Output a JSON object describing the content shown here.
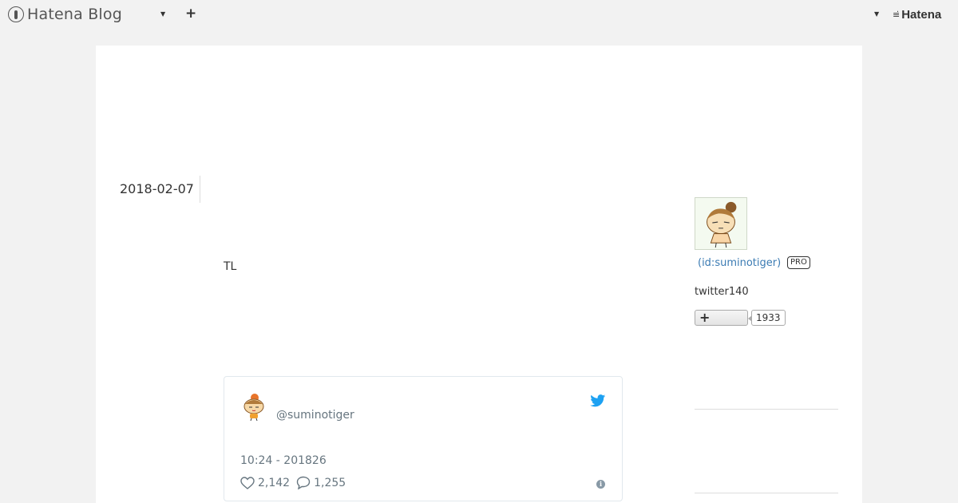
{
  "topbar": {
    "logo_text": "Hatena Blog",
    "brand_right": "Hatena",
    "plus_label": "+"
  },
  "entry": {
    "date": "2018-02-07",
    "text": "TL"
  },
  "tweet": {
    "handle": "@suminotiger",
    "time": "10:24 - 201826",
    "likes": "2,142",
    "replies": "1,255",
    "colors": {
      "bird": "#1da1f2",
      "meta": "#66757f"
    }
  },
  "sidebar": {
    "profile_id": "(id:suminotiger)",
    "badge": "PRO",
    "description": "twitter140",
    "subscribe_count": "1933"
  },
  "colors": {
    "background": "#f2f2f2",
    "panel": "#ffffff",
    "link": "#3b7bb3"
  }
}
